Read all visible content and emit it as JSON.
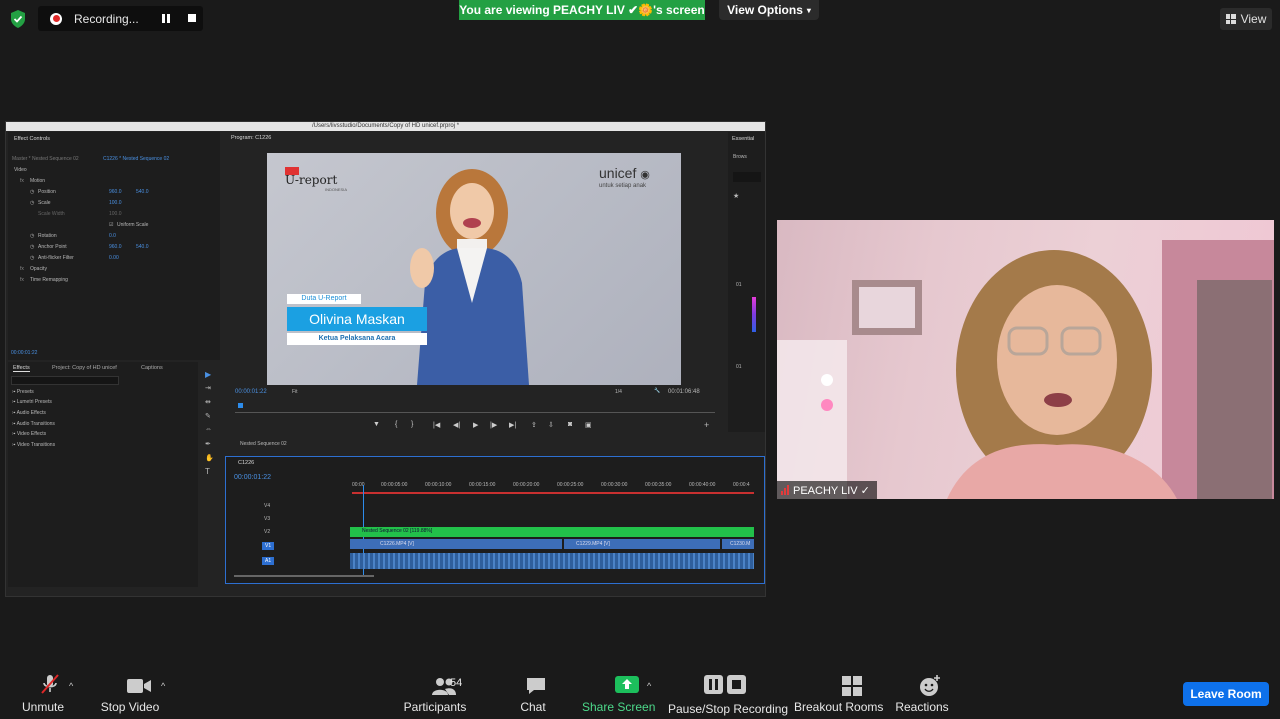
{
  "top": {
    "recording_label": "Recording...",
    "viewing_banner": "You are viewing PEACHY LIV ✔🌼's screen",
    "view_options": "View Options",
    "view_button": "View"
  },
  "premiere": {
    "title": "/Users/livsstudio/Documents/Copy of HD unicef.prproj *",
    "effect_controls": {
      "tab": "Effect Controls",
      "source": "Master * Nested Sequence 02",
      "clip": "C1226 * Nested Sequence 02",
      "video_label": "Video",
      "motion": "Motion",
      "position": "Position",
      "position_x": "960.0",
      "position_y": "540.0",
      "scale": "Scale",
      "scale_value": "100.0",
      "scale_width": "Scale Width",
      "scale_width_value": "100.0",
      "uniform_scale": "Uniform Scale",
      "rotation": "Rotation",
      "rotation_value": "0.0",
      "anchor_point": "Anchor Point",
      "anchor_x": "960.0",
      "anchor_y": "540.0",
      "anti_flicker": "Anti-flicker Filter",
      "anti_flicker_value": "0.00",
      "opacity": "Opacity",
      "time_remapping": "Time Remapping",
      "timecode": "00:00:01:22"
    },
    "effects": {
      "tabs": [
        "Effects",
        "Project: Copy of HD unicef",
        "Captions"
      ],
      "items": [
        "Presets",
        "Lumetri Presets",
        "Audio Effects",
        "Audio Transitions",
        "Video Effects",
        "Video Transitions"
      ]
    },
    "program": {
      "title": "Program: C1226",
      "timecode": "00:00:01:22",
      "fit": "Fit",
      "quality": "1/4",
      "duration": "00:01:06:48",
      "video": {
        "logo_ureport": "U-report",
        "logo_ureport_sub": "INDONESIA",
        "unicef": "unicef",
        "unicef_tagline": "untuk setiap anak",
        "lower_tag": "Duta U-Report",
        "lower_name": "Olivina Maskan",
        "lower_role": "Ketua Pelaksana Acara"
      }
    },
    "essential": {
      "title": "Essential",
      "browse": "Brows",
      "marks": [
        "01",
        "01"
      ]
    },
    "nested": {
      "title": "Nested Sequence 02"
    },
    "timeline": {
      "sequence": "C1226",
      "timecode": "00:00:01:22",
      "ruler": [
        "00:00",
        "00:00:05:00",
        "00:00:10:00",
        "00:00:15:00",
        "00:00:20:00",
        "00:00:25:00",
        "00:00:30:00",
        "00:00:35:00",
        "00:00:40:00",
        "00:00:4"
      ],
      "tracks": [
        "V4",
        "V3",
        "V2",
        "V1",
        "A1"
      ],
      "clip_nested": "Nested Sequence 02 [119.88%]",
      "clip_a": "C1226.MP4 [V]",
      "clip_b": "C1229.MP4 [V]",
      "clip_c": "C1230.M"
    }
  },
  "webcam": {
    "name": "PEACHY LIV ✓"
  },
  "toolbar": {
    "unmute": "Unmute",
    "stop_video": "Stop Video",
    "participants": "Participants",
    "participants_count": "54",
    "chat": "Chat",
    "share_screen": "Share Screen",
    "recording": "Pause/Stop Recording",
    "breakout": "Breakout Rooms",
    "reactions": "Reactions",
    "leave": "Leave Room"
  },
  "colors": {
    "accent_green": "#23a043",
    "leave_blue": "#0e71eb",
    "record_red": "#e02828"
  }
}
